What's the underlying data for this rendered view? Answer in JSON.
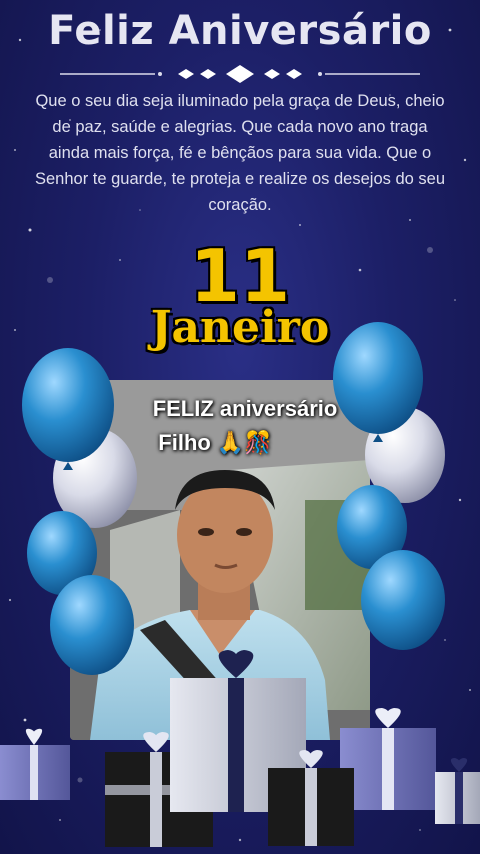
{
  "header": {
    "title": "Feliz Aniversário"
  },
  "message": {
    "text": "Que o seu dia seja iluminado pela graça de Deus, cheio de paz, saúde e alegrias. Que cada novo ano traga ainda mais força, fé e bênçãos para sua vida. Que o Senhor te guarde, te proteja e realize os desejos do seu coração."
  },
  "date": {
    "day": "11",
    "month": "Janeiro"
  },
  "photo": {
    "caption_line1": "FELIZ aniversário",
    "caption_line2": "Filho 🙏🎊"
  },
  "colors": {
    "background": "#1c1f66",
    "gold": "#f4c400",
    "balloon_blue": "#2a8fd0",
    "balloon_silver": "#d9dbe8",
    "gift_silver": "#c9ccd8",
    "gift_black": "#1a1a1a",
    "gift_purple": "#6f72b8"
  }
}
